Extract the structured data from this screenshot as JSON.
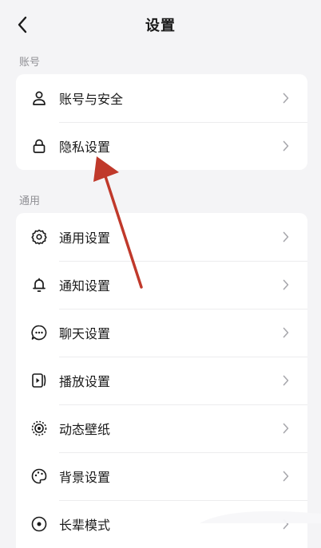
{
  "header": {
    "title": "设置",
    "back_icon": "chevron-left-icon"
  },
  "sections": {
    "account": {
      "label": "账号",
      "items": [
        {
          "label": "账号与安全",
          "icon": "user-icon"
        },
        {
          "label": "隐私设置",
          "icon": "lock-icon"
        }
      ]
    },
    "general": {
      "label": "通用",
      "items": [
        {
          "label": "通用设置",
          "icon": "gear-icon"
        },
        {
          "label": "通知设置",
          "icon": "bell-icon"
        },
        {
          "label": "聊天设置",
          "icon": "chat-icon"
        },
        {
          "label": "播放设置",
          "icon": "play-icon"
        },
        {
          "label": "动态壁纸",
          "icon": "wallpaper-icon"
        },
        {
          "label": "背景设置",
          "icon": "palette-icon"
        },
        {
          "label": "长辈模式",
          "icon": "elder-mode-icon"
        }
      ]
    }
  },
  "annotation": {
    "arrow_color": "#c0392b"
  },
  "colors": {
    "background": "#f4f4f6",
    "card": "#ffffff",
    "chevron": "#a8a8ad"
  }
}
